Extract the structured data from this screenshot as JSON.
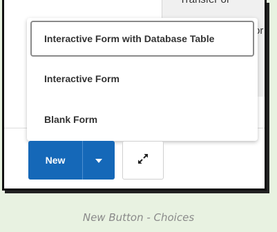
{
  "background": {
    "line1": "Transfer of",
    "line2": "or"
  },
  "menu": {
    "items": [
      {
        "label": "Interactive Form with Database Table"
      },
      {
        "label": "Interactive Form"
      },
      {
        "label": "Blank Form"
      }
    ]
  },
  "toolbar": {
    "new_label": "New",
    "dropdown_icon": "caret-down-icon",
    "expand_icon": "expand-arrows-icon"
  },
  "caption": "New Button - Choices",
  "colors": {
    "primary": "#1568b8",
    "page_background": "#e8f2e1",
    "caption_text": "#8a8a8a"
  }
}
